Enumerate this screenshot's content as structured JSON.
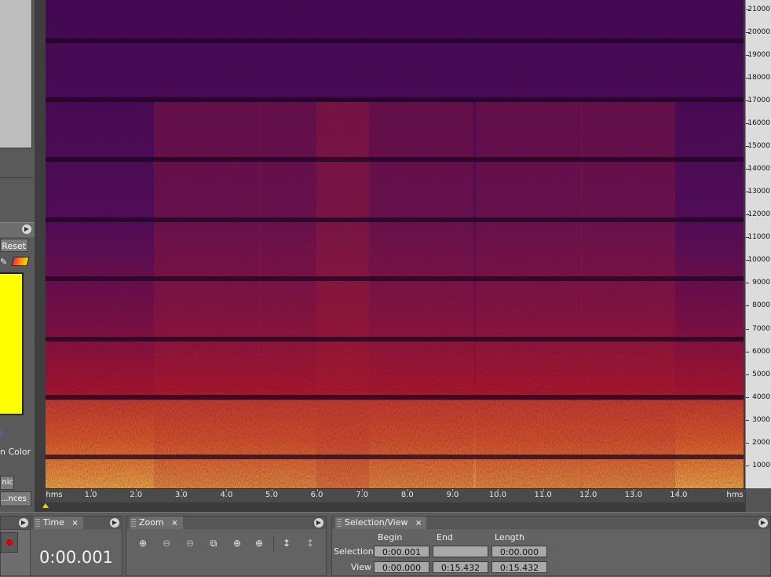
{
  "left_panel": {
    "reset_label": "Reset",
    "color_label": "n Color",
    "blue_link": "l",
    "harmonic_label": "nic",
    "preferences_label": "nces..."
  },
  "spectrogram": {
    "freq_labels": [
      "1000",
      "2000",
      "3000",
      "4000",
      "5000",
      "6000",
      "7000",
      "8000",
      "9000",
      "10000",
      "11000",
      "12000",
      "13000",
      "14000",
      "15000",
      "16000",
      "17000",
      "18000",
      "19000",
      "20000",
      "21000"
    ],
    "time_labels": [
      "hms",
      "1.0",
      "2.0",
      "3.0",
      "4.0",
      "5.0",
      "6.0",
      "7.0",
      "8.0",
      "9.0",
      "10.0",
      "11.0",
      "12.0",
      "13.0",
      "14.0",
      "hms"
    ],
    "colors": {
      "low": "#2a0b3d",
      "mid": "#b01818",
      "high": "#ffe040"
    }
  },
  "panels": {
    "time": {
      "tab": "Time",
      "close": "×",
      "value": "0:00.001"
    },
    "zoom": {
      "tab": "Zoom",
      "close": "×"
    },
    "selection": {
      "tab": "Selection/View",
      "close": "×",
      "col_begin": "Begin",
      "col_end": "End",
      "col_length": "Length",
      "row_selection": "Selection",
      "row_view": "View",
      "selection_begin": "0:00.001",
      "selection_end": "",
      "selection_length": "0:00.000",
      "view_begin": "0:00.000",
      "view_end": "0:15.432",
      "view_length": "0:15.432"
    }
  }
}
